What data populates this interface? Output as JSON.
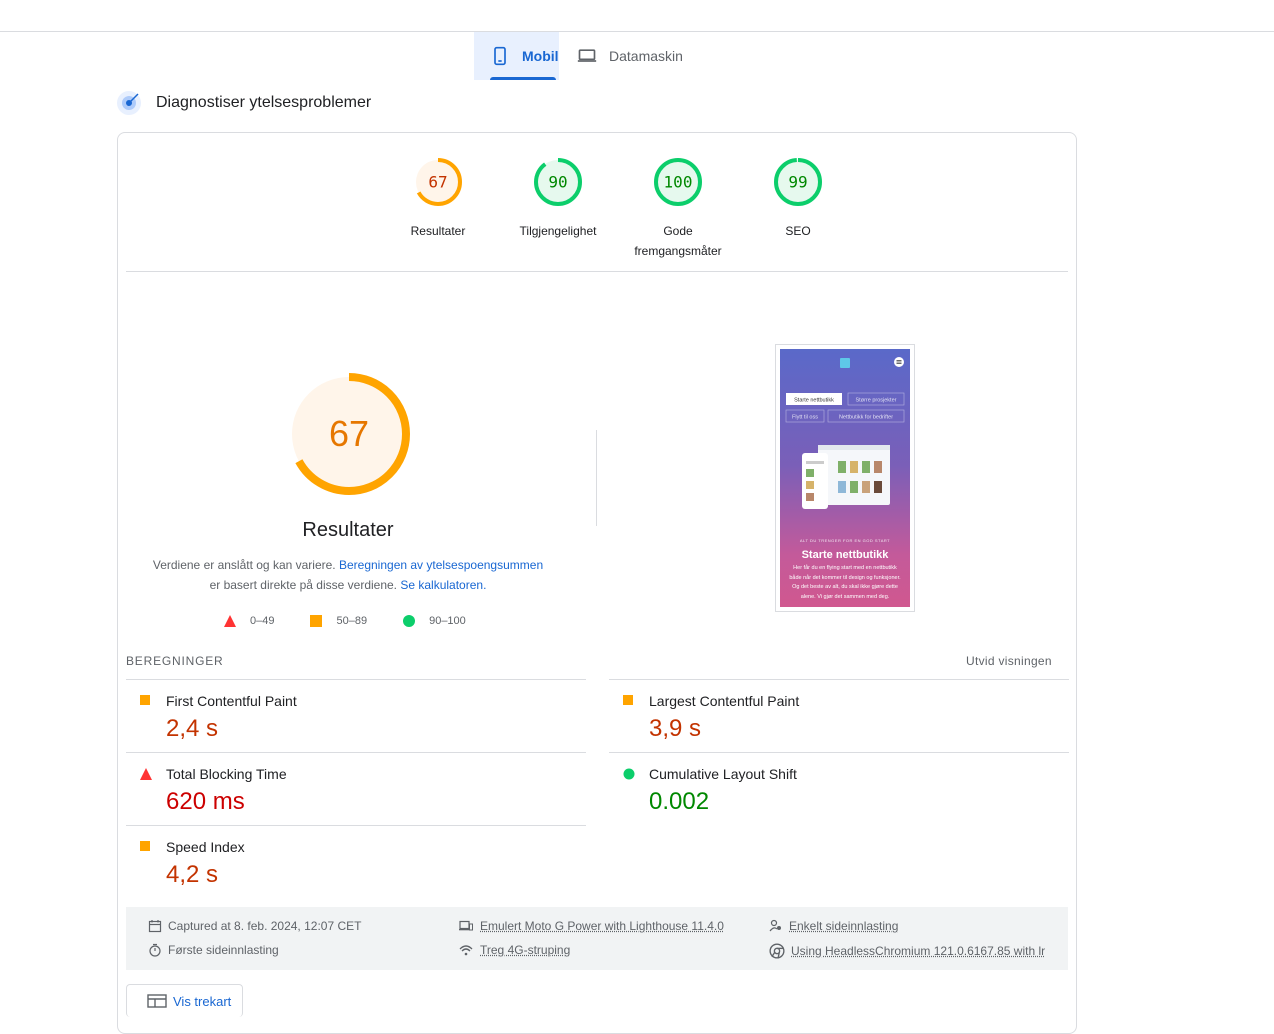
{
  "tabs": [
    {
      "label": "Mobil",
      "icon": "smartphone-icon",
      "active": true
    },
    {
      "label": "Datamaskin",
      "icon": "laptop-icon",
      "active": false
    }
  ],
  "section_title": "Diagnostiser ytelsesproblemer",
  "categories": [
    {
      "score": "67",
      "label": "Resultater",
      "status": "average"
    },
    {
      "score": "90",
      "label": "Tilgjengelighet",
      "status": "pass"
    },
    {
      "score": "100",
      "label": "Gode fremgangsmåter",
      "status": "pass"
    },
    {
      "score": "99",
      "label": "SEO",
      "status": "pass"
    }
  ],
  "performance": {
    "score": "67",
    "title": "Resultater",
    "desc_text_1": "Verdiene er anslått og kan variere.",
    "desc_link_1": "Beregningen av ytelsespoengsummen",
    "desc_text_2": "er basert direkte på disse verdiene.",
    "desc_link_2": "Se kalkulatoren."
  },
  "legend": [
    {
      "range": "0–49",
      "status": "fail",
      "color": "#ff3333"
    },
    {
      "range": "50–89",
      "status": "average",
      "color": "#ffaa33"
    },
    {
      "range": "90–100",
      "status": "pass",
      "color": "#0cce6b"
    }
  ],
  "screenshot": {
    "menu_btn_1": "Starte nettbutikk",
    "menu_btn_2": "Større prosjekter",
    "menu_btn_3": "Flytt til oss",
    "menu_btn_4": "Nettbutikk for bedrifter",
    "eyebrow": "ALT DU TRENGER FOR EN GOD START",
    "heading": "Starte nettbutikk",
    "body": "Her får du en flying start med en nettbutikk både når det kommer til design og funksjoner. Og det beste av alt, du skal ikke gjøre dette alene. Vi gjør det sammen med deg."
  },
  "metrics_header": "BEREGNINGER",
  "expand_label": "Utvid visningen",
  "metrics": [
    {
      "name": "First Contentful Paint",
      "value": "2,4 s",
      "status": "average"
    },
    {
      "name": "Largest Contentful Paint",
      "value": "3,9 s",
      "status": "average"
    },
    {
      "name": "Total Blocking Time",
      "value": "620 ms",
      "status": "fail"
    },
    {
      "name": "Cumulative Layout Shift",
      "value": "0.002",
      "status": "pass"
    },
    {
      "name": "Speed Index",
      "value": "4,2 s",
      "status": "average"
    }
  ],
  "runtime": {
    "captured": "Captured at 8. feb. 2024, 12:07 CET",
    "device": "Emulert Moto G Power with Lighthouse 11.4.0",
    "session": "Enkelt sideinnlasting",
    "load": "Første sideinnlasting",
    "throttling": "Treg 4G-struping",
    "browser": "Using HeadlessChromium 121.0.6167.85 with lr"
  },
  "treemap_label": "Vis trekart",
  "colors": {
    "accent": "#1967d2",
    "average": "#ffa400",
    "average_text": "#c33300",
    "fail": "#ff3333",
    "fail_text": "#cc0000",
    "pass": "#0cce6b",
    "pass_text": "#008800"
  }
}
